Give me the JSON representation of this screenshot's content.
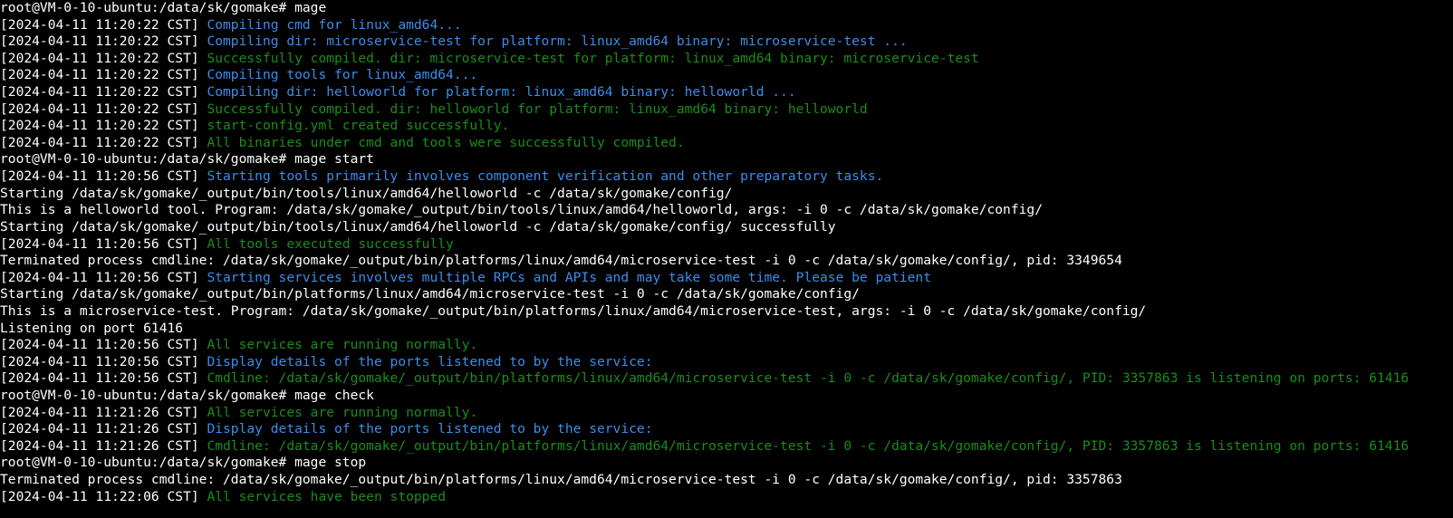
{
  "colors": {
    "background": "#000000",
    "default_text": "#ffffff",
    "info_blue": "#3b8eea",
    "success_green": "#1a8e1a"
  },
  "lines": [
    {
      "kind": "prompt",
      "prompt": "root@VM-0-10-ubuntu:/data/sk/gomake# ",
      "command": "mage"
    },
    {
      "kind": "log",
      "level": "info",
      "timestamp": "[2024-04-11 11:20:22 CST] ",
      "message": "Compiling cmd for linux_amd64..."
    },
    {
      "kind": "log",
      "level": "info",
      "timestamp": "[2024-04-11 11:20:22 CST] ",
      "message": "Compiling dir: microservice-test for platform: linux_amd64 binary: microservice-test ..."
    },
    {
      "kind": "log",
      "level": "ok",
      "timestamp": "[2024-04-11 11:20:22 CST] ",
      "message": "Successfully compiled. dir: microservice-test for platform: linux_amd64 binary: microservice-test"
    },
    {
      "kind": "log",
      "level": "info",
      "timestamp": "[2024-04-11 11:20:22 CST] ",
      "message": "Compiling tools for linux_amd64..."
    },
    {
      "kind": "log",
      "level": "info",
      "timestamp": "[2024-04-11 11:20:22 CST] ",
      "message": "Compiling dir: helloworld for platform: linux_amd64 binary: helloworld ..."
    },
    {
      "kind": "log",
      "level": "ok",
      "timestamp": "[2024-04-11 11:20:22 CST] ",
      "message": "Successfully compiled. dir: helloworld for platform: linux_amd64 binary: helloworld"
    },
    {
      "kind": "log",
      "level": "ok",
      "timestamp": "[2024-04-11 11:20:22 CST] ",
      "message": "start-config.yml created successfully."
    },
    {
      "kind": "log",
      "level": "ok",
      "timestamp": "[2024-04-11 11:20:22 CST] ",
      "message": "All binaries under cmd and tools were successfully compiled."
    },
    {
      "kind": "prompt",
      "prompt": "root@VM-0-10-ubuntu:/data/sk/gomake# ",
      "command": "mage start"
    },
    {
      "kind": "log",
      "level": "info",
      "timestamp": "[2024-04-11 11:20:56 CST] ",
      "message": "Starting tools primarily involves component verification and other preparatory tasks."
    },
    {
      "kind": "plain",
      "text": "Starting /data/sk/gomake/_output/bin/tools/linux/amd64/helloworld -c /data/sk/gomake/config/"
    },
    {
      "kind": "plain",
      "text": "This is a helloworld tool. Program: /data/sk/gomake/_output/bin/tools/linux/amd64/helloworld, args: -i 0 -c /data/sk/gomake/config/"
    },
    {
      "kind": "plain",
      "text": "Starting /data/sk/gomake/_output/bin/tools/linux/amd64/helloworld -c /data/sk/gomake/config/ successfully"
    },
    {
      "kind": "log",
      "level": "ok",
      "timestamp": "[2024-04-11 11:20:56 CST] ",
      "message": "All tools executed successfully"
    },
    {
      "kind": "plain",
      "text": "Terminated process cmdline: /data/sk/gomake/_output/bin/platforms/linux/amd64/microservice-test -i 0 -c /data/sk/gomake/config/, pid: 3349654"
    },
    {
      "kind": "log",
      "level": "info",
      "timestamp": "[2024-04-11 11:20:56 CST] ",
      "message": "Starting services involves multiple RPCs and APIs and may take some time. Please be patient"
    },
    {
      "kind": "plain",
      "text": "Starting /data/sk/gomake/_output/bin/platforms/linux/amd64/microservice-test -i 0 -c /data/sk/gomake/config/"
    },
    {
      "kind": "plain",
      "text": "This is a microservice-test. Program: /data/sk/gomake/_output/bin/platforms/linux/amd64/microservice-test, args: -i 0 -c /data/sk/gomake/config/"
    },
    {
      "kind": "plain",
      "text": "Listening on port 61416"
    },
    {
      "kind": "log",
      "level": "ok",
      "timestamp": "[2024-04-11 11:20:56 CST] ",
      "message": "All services are running normally."
    },
    {
      "kind": "log",
      "level": "info",
      "timestamp": "[2024-04-11 11:20:56 CST] ",
      "message": "Display details of the ports listened to by the service:"
    },
    {
      "kind": "log",
      "level": "ok",
      "timestamp": "[2024-04-11 11:20:56 CST] ",
      "message": "Cmdline: /data/sk/gomake/_output/bin/platforms/linux/amd64/microservice-test -i 0 -c /data/sk/gomake/config/, PID: 3357863 is listening on ports: 61416"
    },
    {
      "kind": "prompt",
      "prompt": "root@VM-0-10-ubuntu:/data/sk/gomake# ",
      "command": "mage check"
    },
    {
      "kind": "log",
      "level": "ok",
      "timestamp": "[2024-04-11 11:21:26 CST] ",
      "message": "All services are running normally."
    },
    {
      "kind": "log",
      "level": "info",
      "timestamp": "[2024-04-11 11:21:26 CST] ",
      "message": "Display details of the ports listened to by the service:"
    },
    {
      "kind": "log",
      "level": "ok",
      "timestamp": "[2024-04-11 11:21:26 CST] ",
      "message": "Cmdline: /data/sk/gomake/_output/bin/platforms/linux/amd64/microservice-test -i 0 -c /data/sk/gomake/config/, PID: 3357863 is listening on ports: 61416"
    },
    {
      "kind": "prompt",
      "prompt": "root@VM-0-10-ubuntu:/data/sk/gomake# ",
      "command": "mage stop"
    },
    {
      "kind": "plain",
      "text": "Terminated process cmdline: /data/sk/gomake/_output/bin/platforms/linux/amd64/microservice-test -i 0 -c /data/sk/gomake/config/, pid: 3357863"
    },
    {
      "kind": "log",
      "level": "ok",
      "timestamp": "[2024-04-11 11:22:06 CST] ",
      "message": "All services have been stopped"
    }
  ]
}
